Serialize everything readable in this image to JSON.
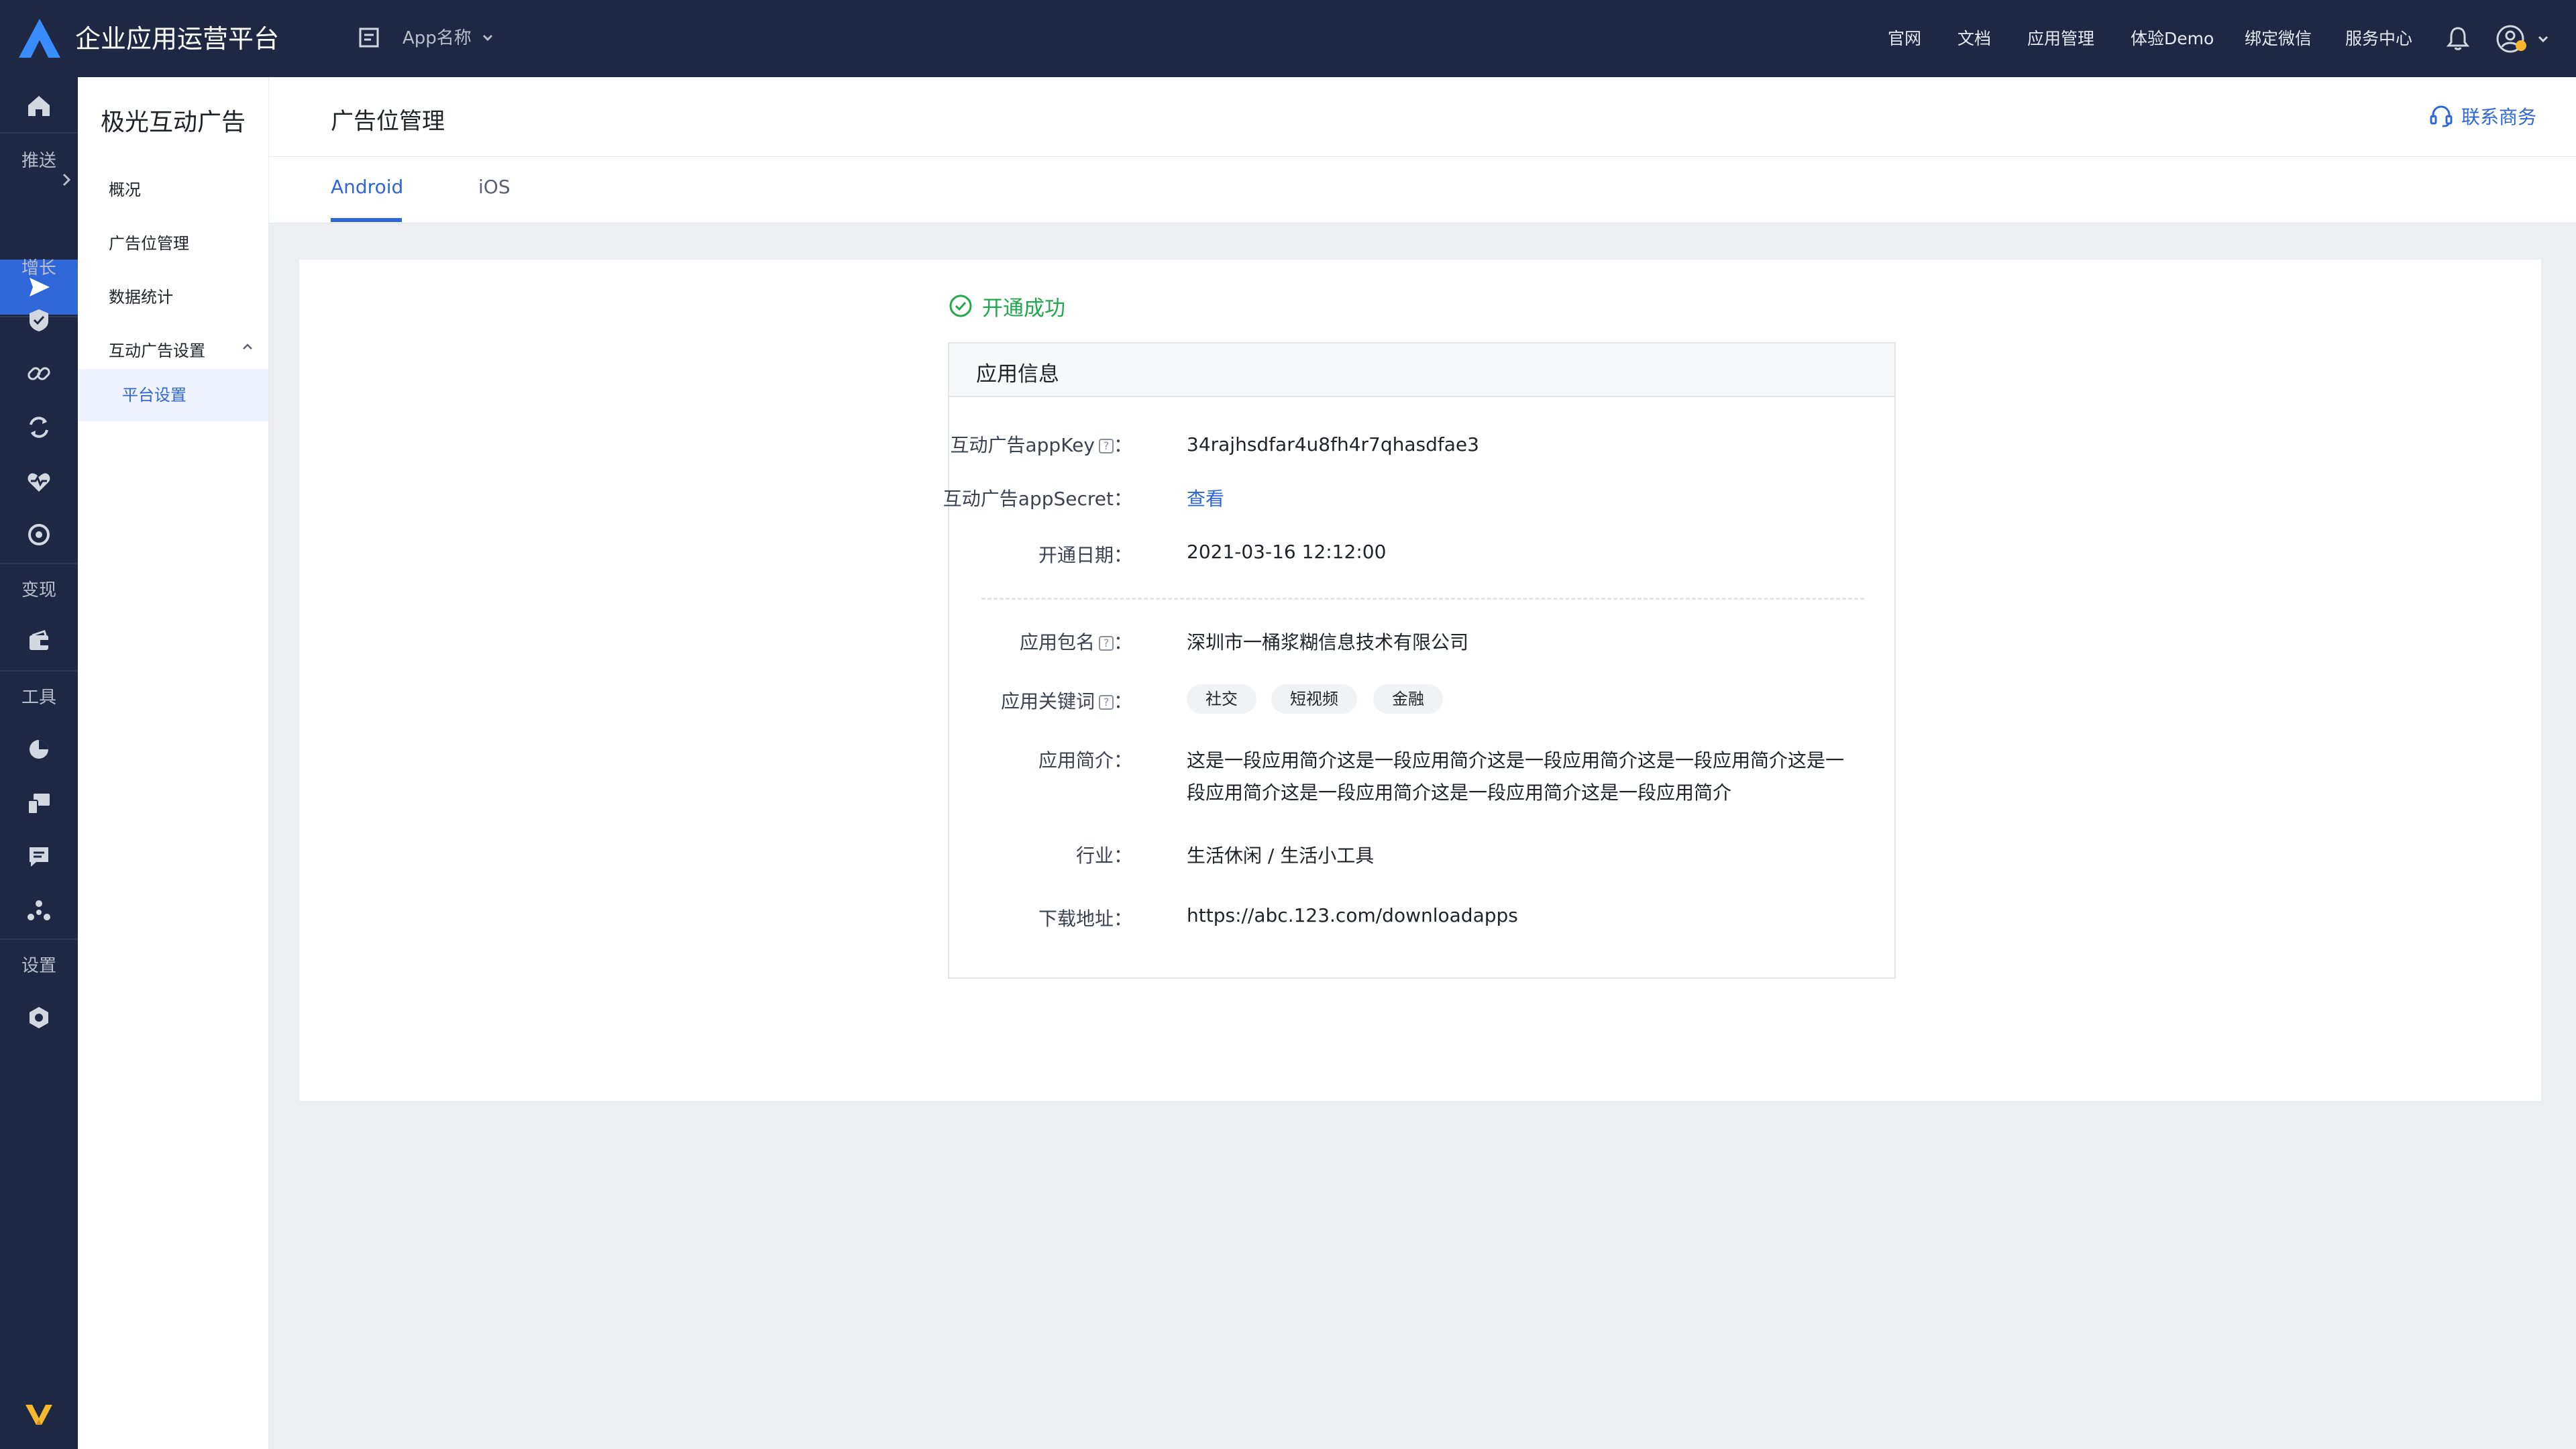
{
  "topbar": {
    "brand": "企业应用运营平台",
    "app_name": "App名称",
    "nav": [
      "官网",
      "文档",
      "应用管理",
      "体验Demo",
      "绑定微信",
      "服务中心"
    ]
  },
  "rail": {
    "labels": {
      "push": "推送",
      "growth": "增长",
      "monetize": "变现",
      "tools": "工具",
      "settings": "设置"
    },
    "icons": [
      "home-icon",
      "send-icon",
      "shield-icon",
      "link-icon",
      "refresh-icon",
      "heartbeat-icon",
      "target-icon",
      "wallet-icon",
      "pie-chart-icon",
      "devices-icon",
      "chat-icon",
      "cluster-icon",
      "hexagon-gear-icon",
      "logo-icon"
    ]
  },
  "sidenav": {
    "title": "极光互动广告",
    "items": [
      "概况",
      "广告位管理",
      "数据统计",
      "互动广告设置"
    ],
    "sub_item": "平台设置"
  },
  "header": {
    "title": "广告位管理",
    "contact": "联系商务"
  },
  "tabs": [
    "Android",
    "iOS"
  ],
  "status": "开通成功",
  "info": {
    "title": "应用信息",
    "appkey_label": "互动广告appKey",
    "appkey_value": "34rajhsdfar4u8fh4r7qhasdfae3",
    "secret_label": "互动广告appSecret：",
    "secret_value": "查看",
    "date_label": "开通日期：",
    "date_value": "2021-03-16 12:12:00",
    "package_label": "应用包名",
    "package_value": "深圳市一桶浆糊信息技术有限公司",
    "keywords_label": "应用关键词",
    "keywords": [
      "社交",
      "短视频",
      "金融"
    ],
    "intro_label": "应用简介：",
    "intro_value": "这是一段应用简介这是一段应用简介这是一段应用简介这是一段应用简介这是一段应用简介这是一段应用简介这是一段应用简介这是一段应用简介",
    "industry_label": "行业：",
    "industry_value": "生活休闲 / 生活小工具",
    "download_label": "下载地址：",
    "download_value": "https://abc.123.com/downloadapps"
  }
}
